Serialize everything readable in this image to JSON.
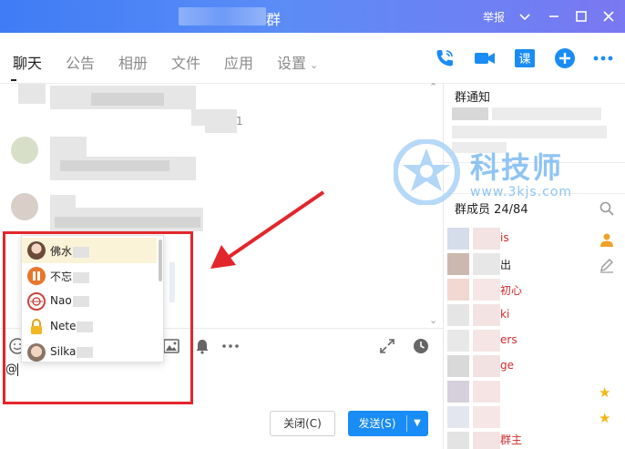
{
  "window": {
    "title_suffix": "群",
    "report_label": "举报"
  },
  "tabs": [
    {
      "label": "聊天"
    },
    {
      "label": "公告"
    },
    {
      "label": "相册"
    },
    {
      "label": "文件"
    },
    {
      "label": "应用"
    },
    {
      "label": "设置"
    }
  ],
  "chat": {
    "message_fragment": "1"
  },
  "mention_list": {
    "items": [
      {
        "name": "佛水"
      },
      {
        "name": "不忘"
      },
      {
        "name": "Nao"
      },
      {
        "name": "Nete"
      },
      {
        "name": "Silka"
      }
    ]
  },
  "input": {
    "value": "@"
  },
  "buttons": {
    "close": "关闭(C)",
    "send": "发送(S)"
  },
  "notice": {
    "title": "群通知"
  },
  "members": {
    "title": "群成员 24/84",
    "items": [
      {
        "name": "is"
      },
      {
        "name": "出"
      },
      {
        "name": "初心"
      },
      {
        "name": "ki"
      },
      {
        "name": "ers"
      },
      {
        "name": "ge"
      },
      {
        "name": ""
      },
      {
        "name": ""
      },
      {
        "name": "群主"
      }
    ]
  },
  "watermark": {
    "brand": "科技师",
    "url": "www.3kjs.com"
  },
  "colors": {
    "accent": "#1a8cf5",
    "titlebar_start": "#3f7cf5",
    "titlebar_end": "#7a78f2",
    "annotation_red": "#e3262b",
    "member_red": "#d02b2b"
  }
}
